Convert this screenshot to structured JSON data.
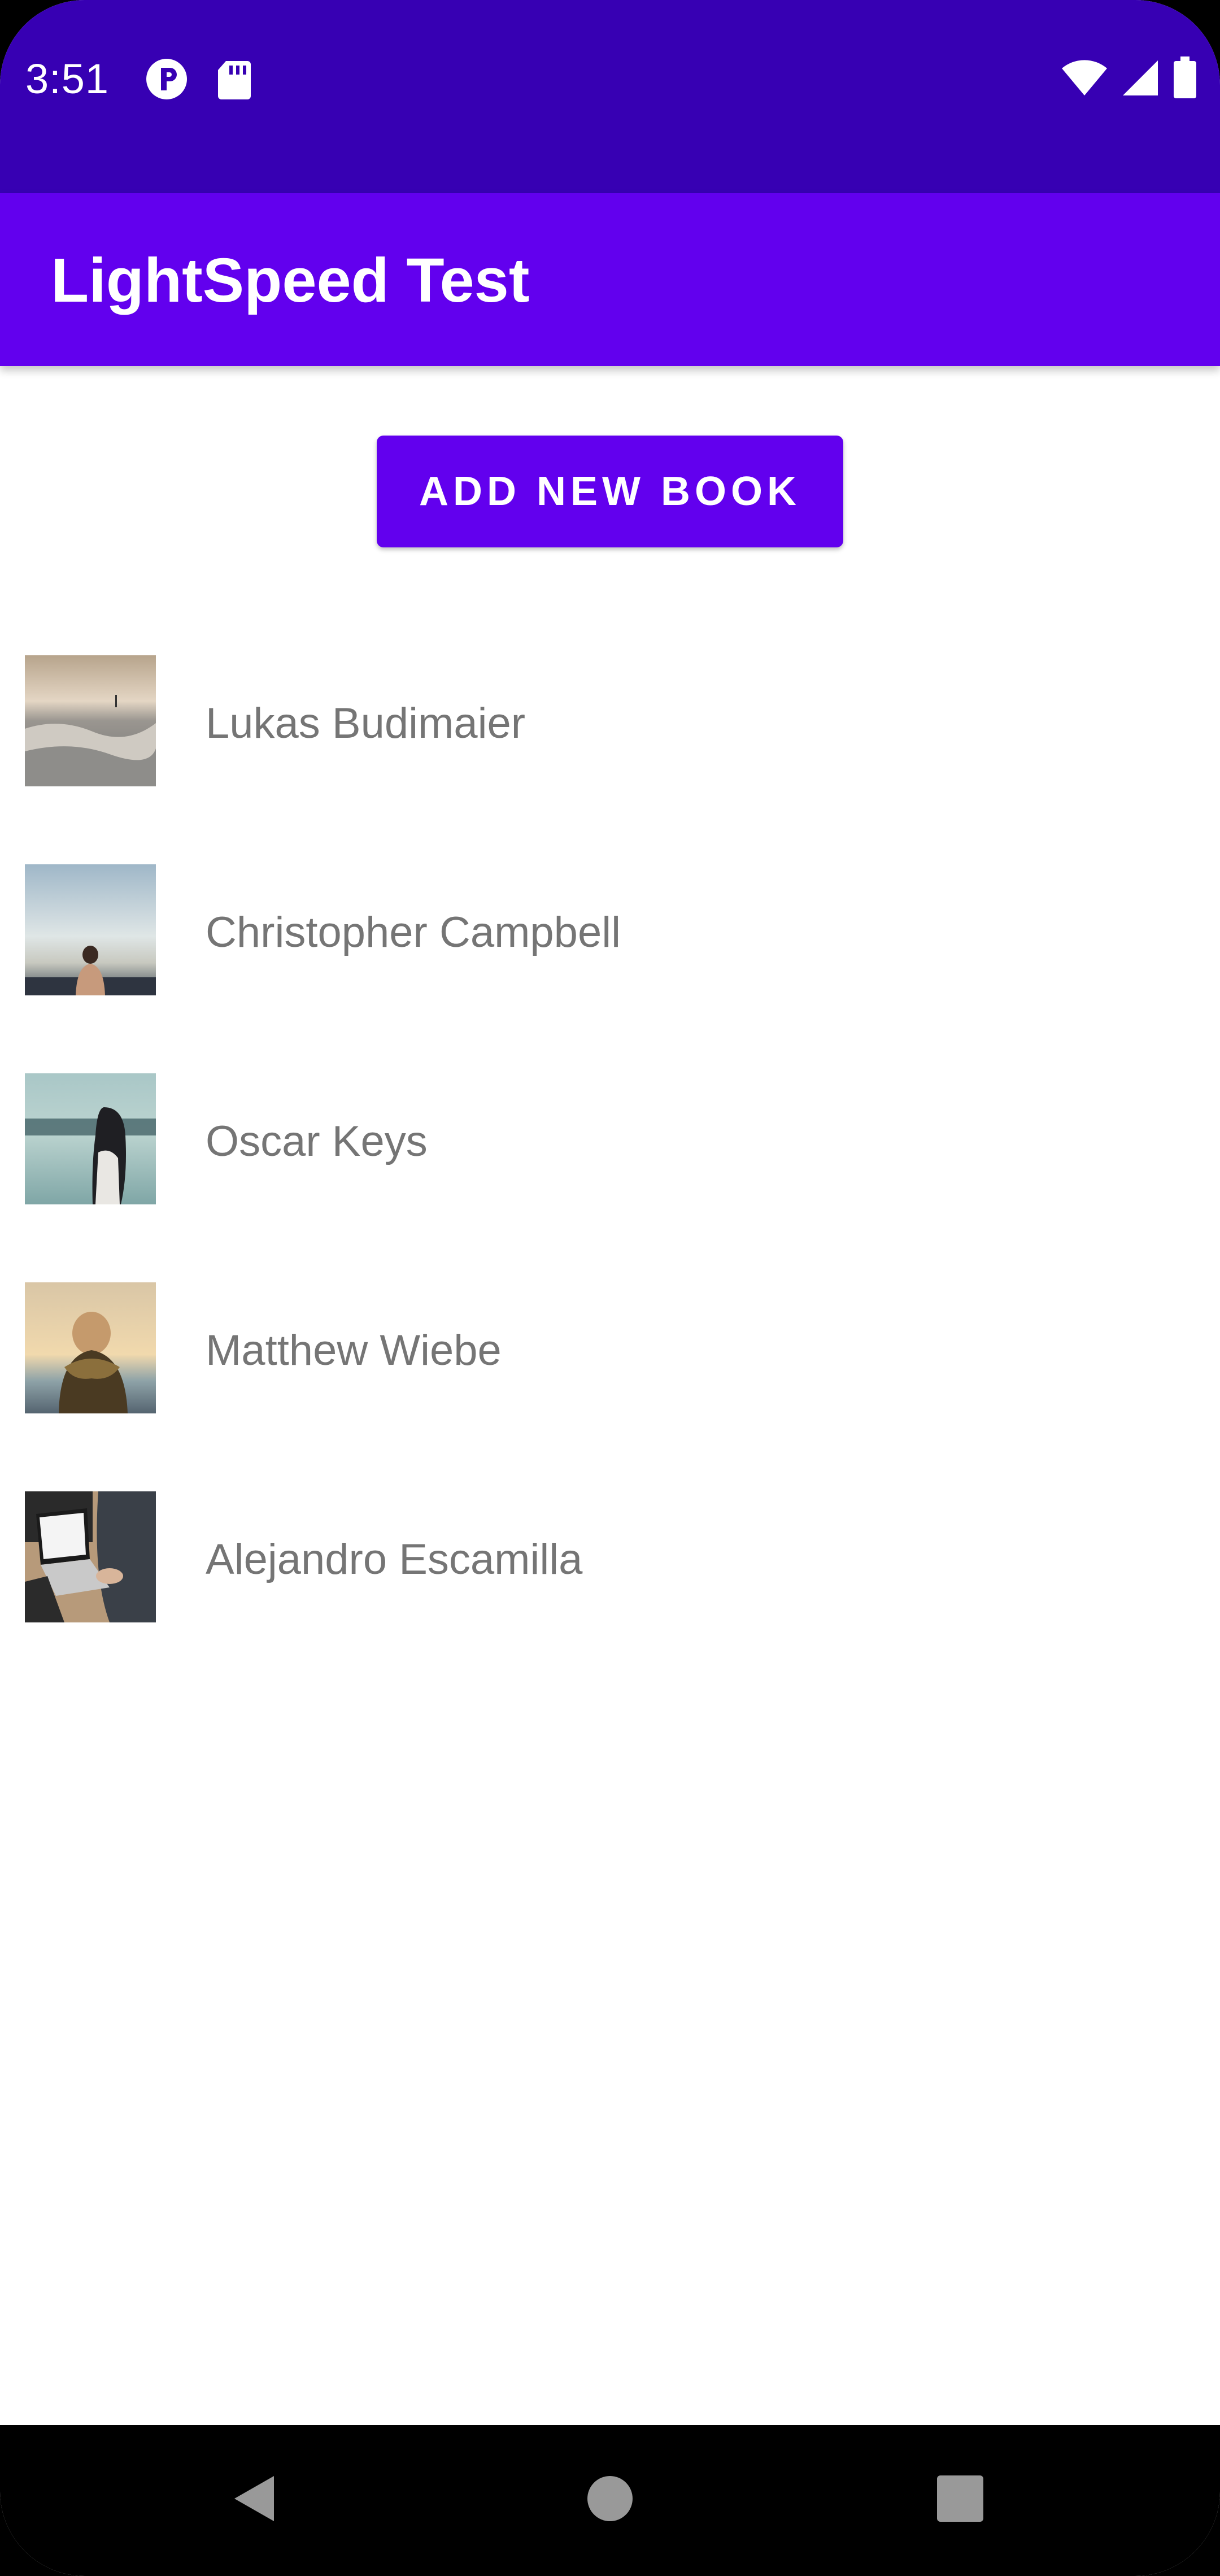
{
  "status_bar": {
    "time": "3:51",
    "left_icons": [
      "notification-p-icon",
      "sd-card-icon"
    ],
    "right_icons": [
      "wifi-icon",
      "cell-signal-icon",
      "battery-icon"
    ],
    "color": "#3700b3"
  },
  "app_bar": {
    "title": "LightSpeed Test",
    "color": "#6200ee"
  },
  "main": {
    "add_button_label": "ADD NEW BOOK",
    "books": [
      {
        "author": "Lukas Budimaier",
        "thumb": "winter-landscape-photo"
      },
      {
        "author": "Christopher Campbell",
        "thumb": "person-at-sea-photo"
      },
      {
        "author": "Oscar Keys",
        "thumb": "woman-by-sea-photo"
      },
      {
        "author": "Matthew Wiebe",
        "thumb": "person-sunset-photo"
      },
      {
        "author": "Alejandro Escamilla",
        "thumb": "laptop-desk-photo"
      }
    ]
  },
  "nav_bar": {
    "buttons": [
      "back-icon",
      "home-icon",
      "recents-icon"
    ]
  }
}
